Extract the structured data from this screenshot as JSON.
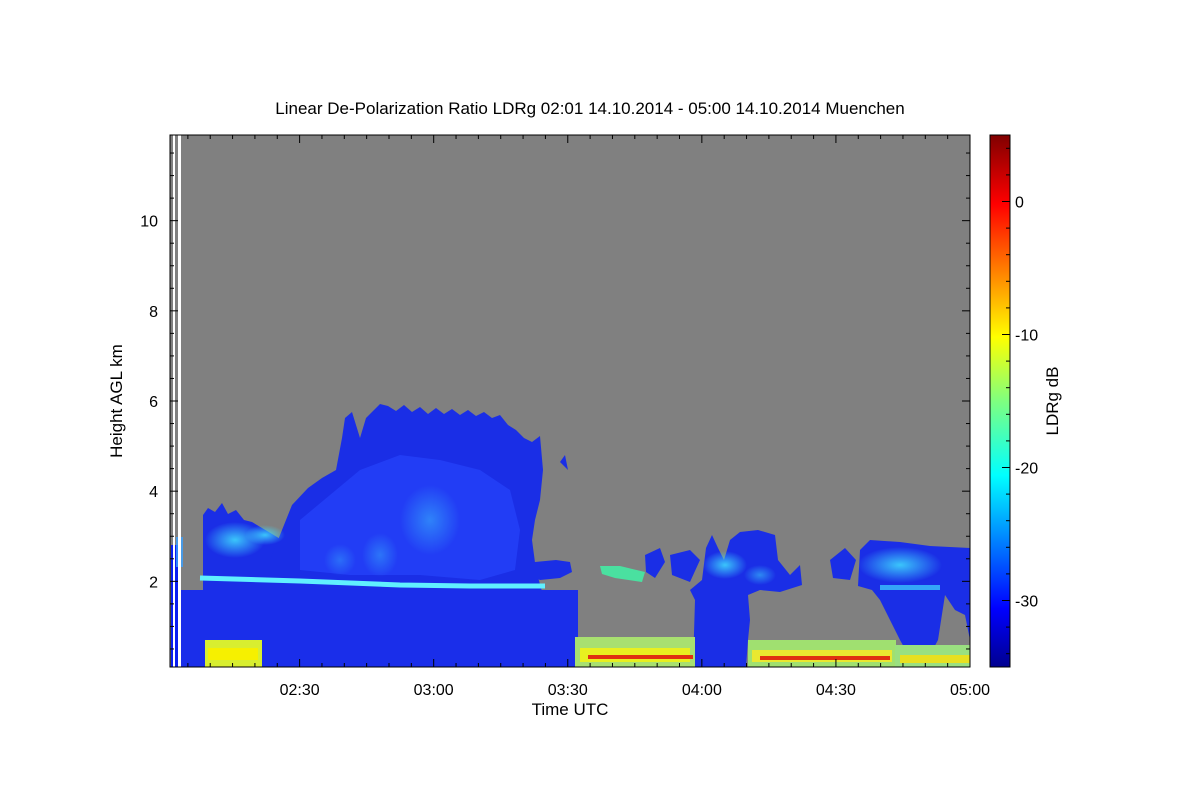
{
  "chart_data": {
    "type": "heatmap",
    "title": "Linear De-Polarization Ratio LDRg   02:01 14.10.2014 - 05:00 14.10.2014 Muenchen",
    "xlabel": "Time UTC",
    "ylabel": "Height AGL km",
    "colorbar_label": "LDRg dB",
    "x_range_minutes": [
      121,
      300
    ],
    "x_ticks": [
      {
        "value": 150,
        "label": "02:30"
      },
      {
        "value": 180,
        "label": "03:00"
      },
      {
        "value": 210,
        "label": "03:30"
      },
      {
        "value": 240,
        "label": "04:00"
      },
      {
        "value": 270,
        "label": "04:30"
      },
      {
        "value": 300,
        "label": "05:00"
      }
    ],
    "ylim": [
      0.1,
      11.9
    ],
    "y_ticks": [
      {
        "value": 2,
        "label": "2"
      },
      {
        "value": 4,
        "label": "4"
      },
      {
        "value": 6,
        "label": "6"
      },
      {
        "value": 8,
        "label": "8"
      },
      {
        "value": 10,
        "label": "10"
      }
    ],
    "colorbar_range": [
      -35,
      5
    ],
    "colorbar_ticks": [
      {
        "value": 0,
        "label": "0"
      },
      {
        "value": -10,
        "label": "-10"
      },
      {
        "value": -20,
        "label": "-20"
      },
      {
        "value": -30,
        "label": "-30"
      }
    ],
    "no_signal_color": "#808080",
    "features": [
      {
        "name": "cloud_main",
        "time_start": 146,
        "time_end": 204,
        "height_top": 5.9,
        "height_base": 0.2,
        "ldr_db": -31
      },
      {
        "name": "cloud_early",
        "time_start": 128,
        "time_end": 146,
        "height_top": 3.5,
        "height_base": 0.2,
        "ldr_db": -31
      },
      {
        "name": "melting_layer",
        "time_start": 130,
        "time_end": 205,
        "height": 1.95,
        "ldr_db": -22
      },
      {
        "name": "cloud_04h",
        "time_start": 240,
        "time_end": 257,
        "height_top": 3.0,
        "height_base": 1.6,
        "ldr_db": -25
      },
      {
        "name": "cloud_0440",
        "time_start": 279,
        "time_end": 300,
        "height_top": 2.8,
        "height_base": 1.6,
        "ldr_db": -24
      },
      {
        "name": "ground_clutter",
        "time_start": 210,
        "time_end": 300,
        "height": 0.35,
        "ldr_db": -12
      }
    ]
  }
}
